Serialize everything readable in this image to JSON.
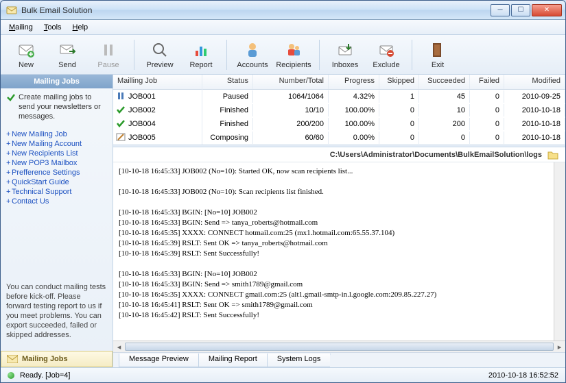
{
  "window": {
    "title": "Bulk Email Solution"
  },
  "menu": {
    "mailing": "Mailing",
    "tools": "Tools",
    "help": "Help"
  },
  "toolbar": {
    "new": "New",
    "send": "Send",
    "pause": "Pause",
    "preview": "Preview",
    "report": "Report",
    "accounts": "Accounts",
    "recipients": "Recipients",
    "inboxes": "Inboxes",
    "exclude": "Exclude",
    "exit": "Exit"
  },
  "sidebar": {
    "header": "Mailing Jobs",
    "desc": "Create mailing jobs to send your newsletters or messages.",
    "links": [
      "New Mailing Job",
      "New Mailing Account",
      "New Recipients List",
      "New POP3 Mailbox",
      "Prefference Settings",
      "QuickStart Guide",
      "Technical Support",
      "Contact Us"
    ],
    "tip": "You can conduct mailing tests before kick-off. Please forward testing report to us if you meet problems. You can export succeeded, failed or skipped addresses.",
    "bottom": "Mailing Jobs"
  },
  "grid": {
    "headers": [
      "Mailling Job",
      "Status",
      "Number/Total",
      "Progress",
      "Skipped",
      "Succeeded",
      "Failed",
      "Modified"
    ],
    "rows": [
      {
        "icon": "pause",
        "name": "JOB001",
        "status": "Paused",
        "nt": "1064/1064",
        "prog": "4.32%",
        "skip": "1",
        "succ": "45",
        "fail": "0",
        "mod": "2010-09-25"
      },
      {
        "icon": "check",
        "name": "JOB002",
        "status": "Finished",
        "nt": "10/10",
        "prog": "100.00%",
        "skip": "0",
        "succ": "10",
        "fail": "0",
        "mod": "2010-10-18"
      },
      {
        "icon": "check",
        "name": "JOB004",
        "status": "Finished",
        "nt": "200/200",
        "prog": "100.00%",
        "skip": "0",
        "succ": "200",
        "fail": "0",
        "mod": "2010-10-18"
      },
      {
        "icon": "compose",
        "name": "JOB005",
        "status": "Composing",
        "nt": "60/60",
        "prog": "0.00%",
        "skip": "0",
        "succ": "0",
        "fail": "0",
        "mod": "2010-10-18"
      }
    ]
  },
  "log": {
    "path": "C:\\Users\\Administrator\\Documents\\BulkEmailSolution\\logs",
    "lines": [
      "[10-10-18 16:45:33] JOB002 (No=10): Started OK, now scan recipients list...",
      "",
      "[10-10-18 16:45:33] JOB002 (No=10): Scan recipients list finished.",
      "",
      "[10-10-18 16:45:33] BGIN: [No=10] JOB002",
      "[10-10-18 16:45:33] BGIN: Send => tanya_roberts@hotmail.com",
      "[10-10-18 16:45:35] XXXX: CONNECT hotmail.com:25 (mx1.hotmail.com:65.55.37.104)",
      "[10-10-18 16:45:39] RSLT: Sent OK => tanya_roberts@hotmail.com",
      "[10-10-18 16:45:39] RSLT: Sent Successfully!",
      "",
      "[10-10-18 16:45:33] BGIN: [No=10] JOB002",
      "[10-10-18 16:45:33] BGIN: Send => smith1789@gmail.com",
      "[10-10-18 16:45:35] XXXX: CONNECT gmail.com:25 (alt1.gmail-smtp-in.l.google.com:209.85.227.27)",
      "[10-10-18 16:45:41] RSLT: Sent OK => smith1789@gmail.com",
      "[10-10-18 16:45:42] RSLT: Sent Successfully!"
    ]
  },
  "tabs": [
    "Message Preview",
    "Mailing Report",
    "System Logs"
  ],
  "status": {
    "text": "Ready. [Job=4]",
    "datetime": "2010-10-18 16:52:52"
  }
}
